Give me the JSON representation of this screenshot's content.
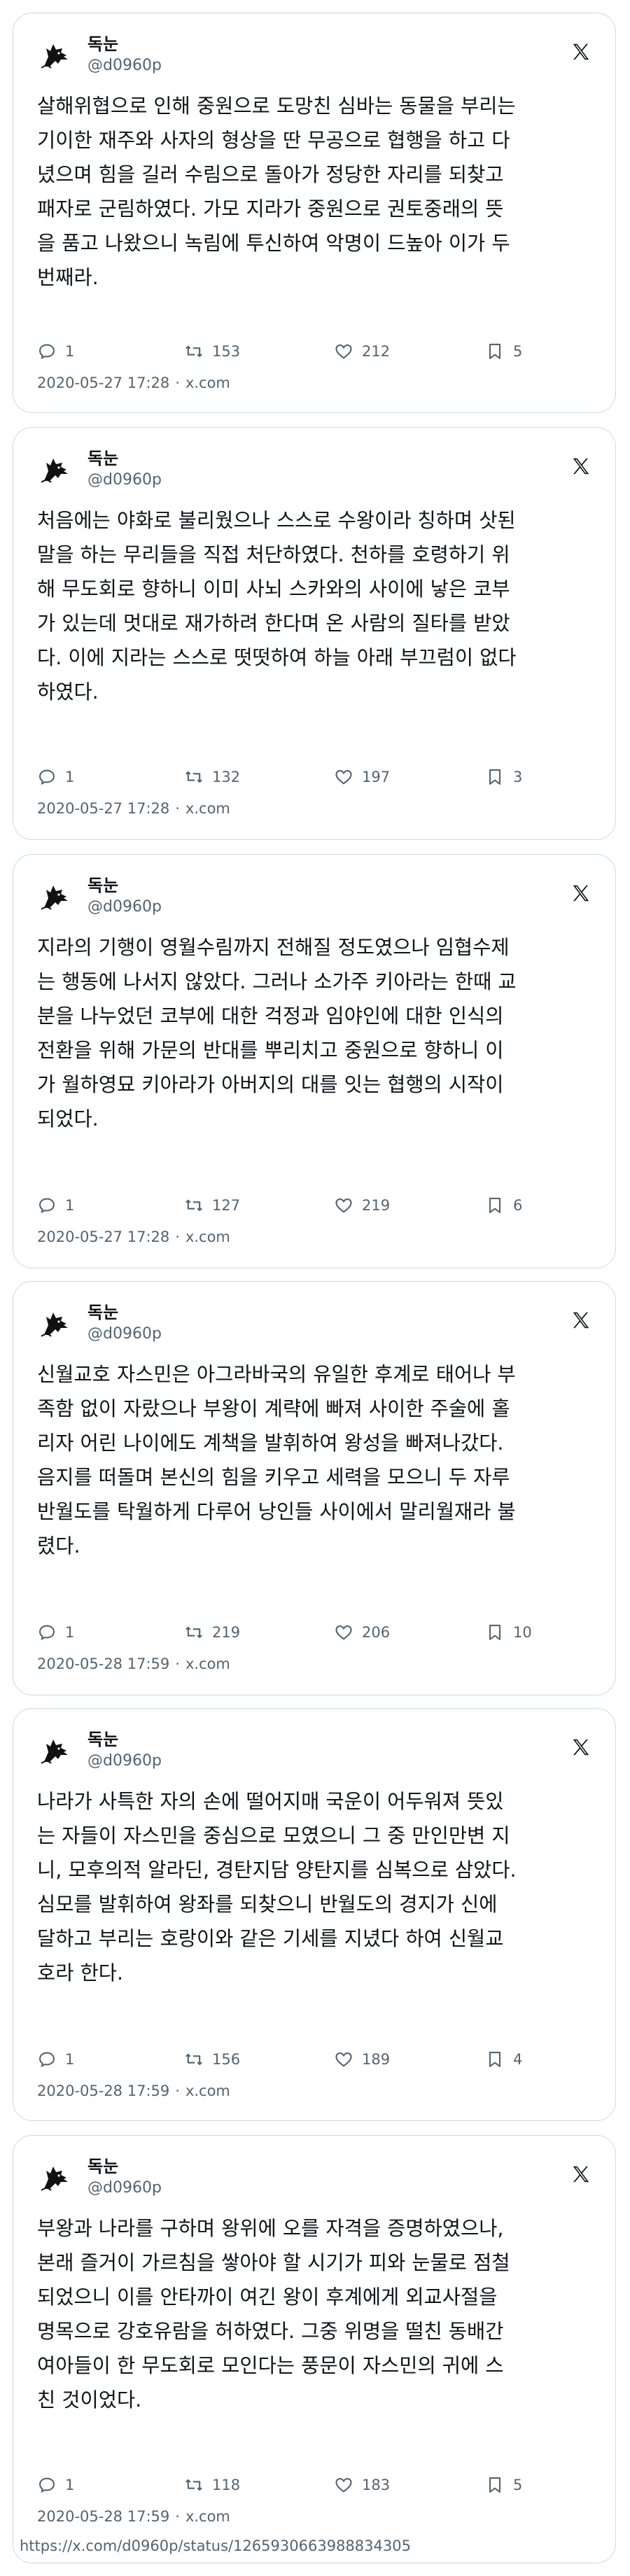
{
  "tweets": [
    {
      "author": "독눈",
      "handle": "@d0960p",
      "text": "살해위협으로 인해 중원으로 도망친 심바는 동물을 부리는\n기이한 재주와 사자의 형상을 딴 무공으로 협행을 하고 다\n녔으며 힘을 길러 수림으로 돌아가 정당한 자리를 되찾고\n패자로 군림하였다. 가모 지라가 중원으로 권토중래의 뜻\n을 품고 나왔으니 녹림에 투신하여 악명이 드높아 이가 두\n번째라.",
      "replies": "1",
      "retweets": "153",
      "likes": "212",
      "bookmarks": "5",
      "datetime": "2020-05-27 17:28",
      "source": "x.com"
    },
    {
      "author": "독눈",
      "handle": "@d0960p",
      "text": "처음에는 야화로 불리웠으나 스스로 수왕이라 칭하며 삿된\n말을 하는 무리들을 직접 처단하였다. 천하를 호령하기 위\n해 무도회로 향하니 이미 사뇌 스카와의 사이에 낳은 코부\n가 있는데 멋대로 재가하려 한다며 온 사람의 질타를 받았\n다. 이에 지라는 스스로 떳떳하여 하늘 아래 부끄럼이 없다\n하였다.",
      "replies": "1",
      "retweets": "132",
      "likes": "197",
      "bookmarks": "3",
      "datetime": "2020-05-27 17:28",
      "source": "x.com"
    },
    {
      "author": "독눈",
      "handle": "@d0960p",
      "text": "지라의 기행이 영월수림까지 전해질 정도였으나 임협수제\n는 행동에 나서지 않았다. 그러나 소가주 키아라는 한때 교\n분을 나누었던 코부에 대한 걱정과 임야인에 대한 인식의\n전환을 위해 가문의 반대를 뿌리치고 중원으로 향하니 이\n가 월하영묘 키아라가 아버지의 대를 잇는 협행의 시작이\n되었다.",
      "replies": "1",
      "retweets": "127",
      "likes": "219",
      "bookmarks": "6",
      "datetime": "2020-05-27 17:28",
      "source": "x.com"
    },
    {
      "author": "독눈",
      "handle": "@d0960p",
      "text": "신월교호 자스민은 아그라바국의 유일한 후계로 태어나 부\n족함 없이 자랐으나 부왕이 계략에 빠져 사이한 주술에 홀\n리자 어린 나이에도 계책을 발휘하여 왕성을 빠져나갔다.\n음지를 떠돌며 본신의 힘을 키우고 세력을 모으니 두 자루\n반월도를 탁월하게 다루어 낭인들 사이에서 말리월재라 불\n렸다.",
      "replies": "1",
      "retweets": "219",
      "likes": "206",
      "bookmarks": "10",
      "datetime": "2020-05-28 17:59",
      "source": "x.com"
    },
    {
      "author": "독눈",
      "handle": "@d0960p",
      "text": "나라가 사특한 자의 손에 떨어지매 국운이 어두워져 뜻있\n는 자들이 자스민을 중심으로 모였으니 그 중 만인만변 지\n니, 모후의적 알라딘, 경탄지담 양탄지를 심복으로 삼았다.\n심모를 발휘하여 왕좌를 되찾으니 반월도의 경지가 신에\n달하고 부리는 호랑이와 같은 기세를 지녔다 하여 신월교\n호라 한다.",
      "replies": "1",
      "retweets": "156",
      "likes": "189",
      "bookmarks": "4",
      "datetime": "2020-05-28 17:59",
      "source": "x.com"
    },
    {
      "author": "독눈",
      "handle": "@d0960p",
      "text": "부왕과 나라를 구하며 왕위에 오를 자격을 증명하였으나,\n본래 즐거이 가르침을 쌓아야 할 시기가 피와 눈물로 점철\n되었으니 이를 안타까이 여긴 왕이 후계에게 외교사절을\n명목으로 강호유람을 허하였다. 그중 위명을 떨친 동배간\n여아들이 한 무도회로 모인다는 풍문이 자스민의 귀에 스\n친 것이었다.",
      "replies": "1",
      "retweets": "118",
      "likes": "183",
      "bookmarks": "5",
      "datetime": "2020-05-28 17:59",
      "source": "x.com"
    }
  ],
  "permalink": "https://x.com/d0960p/status/1265930663988834305",
  "icons": {
    "avatar": "wolf-silhouette-avatar",
    "brand": "x-logo-icon",
    "reply": "reply-icon",
    "retweet": "retweet-icon",
    "like": "heart-icon",
    "bookmark": "bookmark-icon"
  },
  "colors": {
    "text": "#0f1419",
    "muted": "#536471",
    "border": "#cfd9de"
  }
}
